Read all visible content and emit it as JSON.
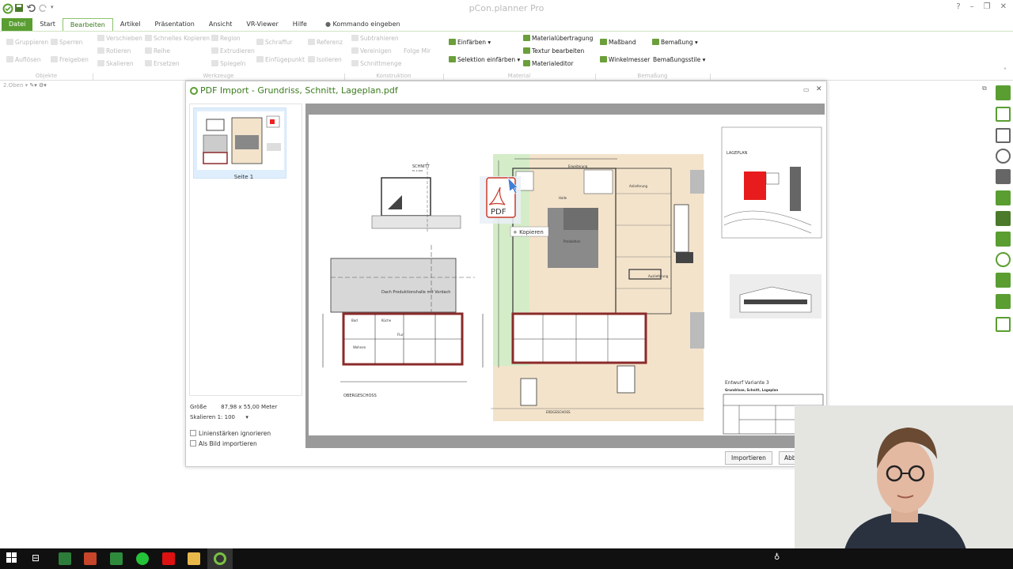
{
  "app": {
    "title": "pCon.planner Pro"
  },
  "menu_tabs": [
    {
      "label": "Datei"
    },
    {
      "label": "Start"
    },
    {
      "label": "Bearbeiten"
    },
    {
      "label": "Artikel"
    },
    {
      "label": "Präsentation"
    },
    {
      "label": "Ansicht"
    },
    {
      "label": "VR-Viewer"
    },
    {
      "label": "Hilfe"
    }
  ],
  "command_search": "Kommando eingeben",
  "window_controls": [
    "?",
    "–",
    "❐",
    "✕"
  ],
  "ribbon": {
    "groups": [
      "Objekte",
      "Werkzeuge",
      "Konstruktion",
      "Material",
      "Bemaßung"
    ],
    "objekte": [
      "Gruppieren",
      "Sperren",
      "Auflösen",
      "Freigeben"
    ],
    "werkzeuge": [
      "Verschieben",
      "Schnelles Kopieren",
      "Region",
      "Rotieren",
      "Reihe",
      "Extrudieren",
      "Skalieren",
      "Ersetzen",
      "Spiegeln",
      "Schraffur",
      "Einfügepunkt",
      "Referenz",
      "Isolieren"
    ],
    "konstruktion": [
      "Subtrahieren",
      "Vereinigen",
      "Schnittmenge",
      "Folge Mir"
    ],
    "material": [
      "Einfärben",
      "Selektion einfärben",
      "Materialübertragung",
      "Textur bearbeiten",
      "Materialeditor"
    ],
    "bemassung": [
      "Maßband",
      "Bemaßung",
      "Winkelmesser",
      "Bemaßungsstile"
    ]
  },
  "view_bar": "2.Oben",
  "dialog": {
    "title": "PDF Import - Grundriss, Schnitt, Lageplan.pdf",
    "page_label": "Seite 1",
    "size_label": "Größe",
    "size_value": "87,98 x 55,00 Meter",
    "scale_label": "Skalieren",
    "scale_ratio": "1:",
    "scale_value": "100",
    "opt_lines": "Linienstärken ignorieren",
    "opt_image": "Als Bild importieren",
    "btn_import": "Importieren",
    "btn_cancel": "Abbrechen"
  },
  "drag": {
    "file_label": "PDF",
    "action": "Kopieren"
  },
  "plan": {
    "schnitt": "SCHNITT",
    "schnitt_scale": "M. 1:100",
    "roof": "Dach Produktionshalle mit Vordach",
    "og": "OBERGESCHOSS",
    "eg": "ERDGESCHOSS",
    "lageplan": "LAGEPLAN",
    "variant": "Entwurf Variante 3",
    "subtitle": "Grundrisse, Schnitt, Lageplan",
    "rooms": [
      "Erweiterung",
      "Halle",
      "Produktion",
      "Anlieferung",
      "Auslieferung",
      "Bad",
      "Flur",
      "Küche",
      "Wohnen"
    ]
  }
}
